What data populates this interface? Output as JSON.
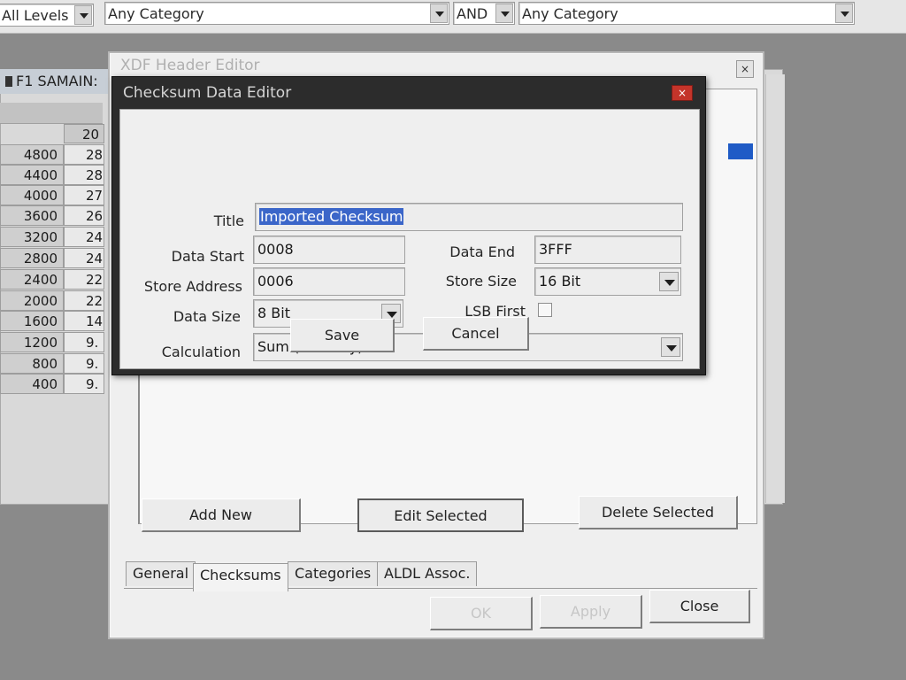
{
  "top_bar": {
    "level_filter": "All Levels",
    "category_filter_1": "Any Category",
    "operator": "AND",
    "category_filter_2": "Any Category"
  },
  "background_window": {
    "title": "F1 SAMAIN:",
    "column_header": "20",
    "rows": [
      {
        "rpm": "4800",
        "value": "28"
      },
      {
        "rpm": "4400",
        "value": "28"
      },
      {
        "rpm": "4000",
        "value": "27"
      },
      {
        "rpm": "3600",
        "value": "26"
      },
      {
        "rpm": "3200",
        "value": "24"
      },
      {
        "rpm": "2800",
        "value": "24"
      },
      {
        "rpm": "2400",
        "value": "22"
      },
      {
        "rpm": "2000",
        "value": "22"
      },
      {
        "rpm": "1600",
        "value": "14"
      },
      {
        "rpm": "1200",
        "value": "9."
      },
      {
        "rpm": "800",
        "value": "9."
      },
      {
        "rpm": "400",
        "value": "9."
      }
    ]
  },
  "header_editor": {
    "title": "XDF Header Editor",
    "close_glyph": "×",
    "buttons": {
      "add_new": "Add New",
      "edit_selected": "Edit Selected",
      "delete_selected": "Delete Selected",
      "ok": "OK",
      "apply": "Apply",
      "close": "Close"
    },
    "tabs": [
      "General",
      "Checksums",
      "Categories",
      "ALDL Assoc."
    ]
  },
  "checksum_editor": {
    "title": "Checksum Data Editor",
    "close_glyph": "×",
    "labels": {
      "title": "Title",
      "data_start": "Data Start",
      "data_end": "Data End",
      "store_address": "Store Address",
      "store_size": "Store Size",
      "data_size": "Data Size",
      "lsb_first": "LSB First",
      "calculation": "Calculation"
    },
    "values": {
      "title": "Imported Checksum",
      "data_start": "0008",
      "data_end": "3FFF",
      "store_address": "0006",
      "store_size": "16 Bit",
      "data_size": "8 Bit",
      "lsb_first": false,
      "calculation": "Sum (no carry)"
    },
    "buttons": {
      "save": "Save",
      "cancel": "Cancel"
    }
  }
}
